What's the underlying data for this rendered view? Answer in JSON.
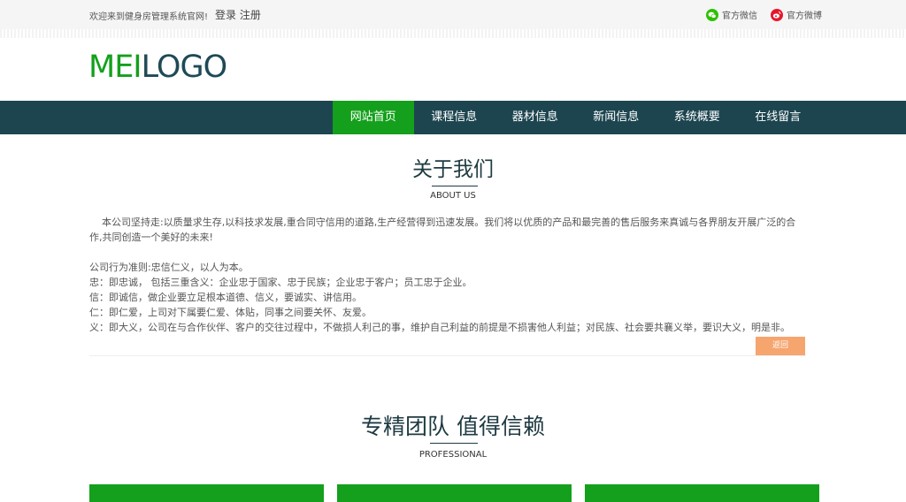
{
  "topbar": {
    "welcome": "欢迎来到健身房管理系统官网!",
    "login": "登录",
    "register": "注册",
    "wechat": "官方微信",
    "weibo": "官方微博"
  },
  "logo": {
    "part1": "MEI",
    "part2": "LOGO"
  },
  "nav": {
    "items": [
      "网站首页",
      "课程信息",
      "器材信息",
      "新闻信息",
      "系统概要",
      "在线留言"
    ],
    "active_index": 0
  },
  "about": {
    "title": "关于我们",
    "subtitle": "ABOUT US",
    "intro": "本公司坚持走:以质量求生存,以科技求发展,重合同守信用的道路,生产经营得到迅速发展。我们将以优质的产品和最完善的售后服务来真诚与各界朋友开展广泛的合作,共同创造一个美好的未来!",
    "lines": [
      "公司行为准则:忠信仁义，以人为本。",
      "忠：即忠诚，  包括三重含义：企业忠于国家、忠于民族；企业忠于客户；员工忠于企业。",
      "信：即诚信，做企业要立足根本道德、信义，要诚实、讲信用。",
      "仁：即仁爱，上司对下属要仁爱、体贴，同事之间要关怀、友爱。",
      "义：即大义，公司在与合作伙伴、客户的交往过程中，不做损人利己的事，维护自己利益的前提是不损害他人利益；对民族、社会要共襄义举，要识大义，明是非。"
    ],
    "back_label": "返回"
  },
  "team": {
    "title": "专精团队 值得信赖",
    "subtitle": "PROFESSIONAL"
  },
  "colors": {
    "brand_green": "#14a01c",
    "nav_bg": "#1d4550",
    "back_button": "#f6a56f"
  },
  "icons": {
    "wechat": "wechat-icon",
    "weibo": "weibo-icon"
  }
}
